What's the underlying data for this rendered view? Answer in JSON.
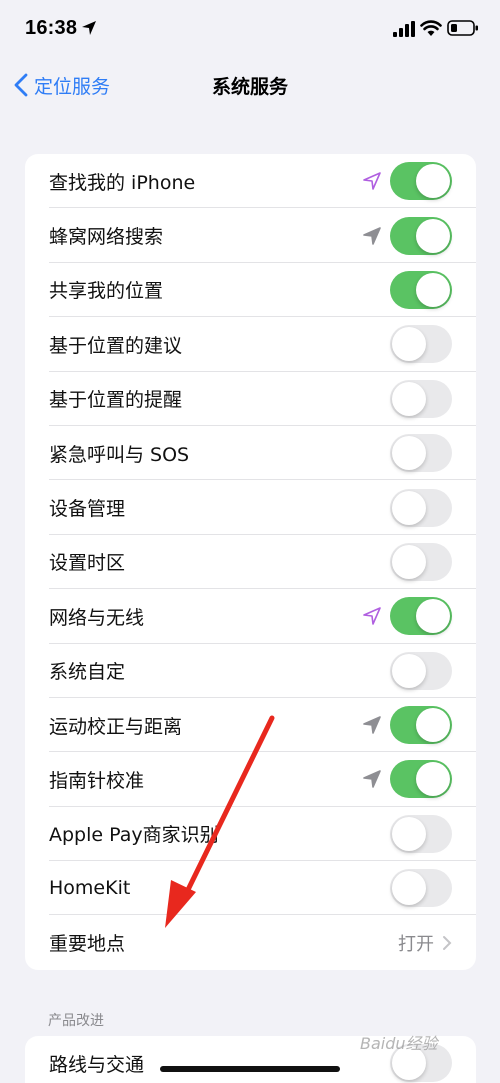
{
  "status_bar": {
    "time": "16:38",
    "icons": [
      "location-arrow-icon",
      "signal-icon",
      "wifi-icon",
      "battery-icon"
    ]
  },
  "nav": {
    "back_label": "定位服务",
    "title": "系统服务"
  },
  "services": [
    {
      "label": "查找我的 iPhone",
      "on": true,
      "indicator": "purple"
    },
    {
      "label": "蜂窝网络搜索",
      "on": true,
      "indicator": "gray"
    },
    {
      "label": "共享我的位置",
      "on": true,
      "indicator": ""
    },
    {
      "label": "基于位置的建议",
      "on": false,
      "indicator": ""
    },
    {
      "label": "基于位置的提醒",
      "on": false,
      "indicator": ""
    },
    {
      "label": "紧急呼叫与 SOS",
      "on": false,
      "indicator": ""
    },
    {
      "label": "设备管理",
      "on": false,
      "indicator": ""
    },
    {
      "label": "设置时区",
      "on": false,
      "indicator": ""
    },
    {
      "label": "网络与无线",
      "on": true,
      "indicator": "purple"
    },
    {
      "label": "系统自定",
      "on": false,
      "indicator": ""
    },
    {
      "label": "运动校正与距离",
      "on": true,
      "indicator": "gray"
    },
    {
      "label": "指南针校准",
      "on": true,
      "indicator": "gray"
    },
    {
      "label": "Apple Pay商家识别",
      "on": false,
      "indicator": ""
    },
    {
      "label": "HomeKit",
      "on": false,
      "indicator": ""
    }
  ],
  "significant_locations": {
    "label": "重要地点",
    "value": "打开"
  },
  "product_improvement": {
    "header": "产品改进",
    "first_item_label": "路线与交通"
  },
  "watermark": "Baidu经验",
  "colors": {
    "toggle_on": "#5ac363",
    "toggle_off": "#e9e9eb",
    "accent": "#2f7df6",
    "indicator_purple": "#b05fe0",
    "indicator_gray": "#8e8e93",
    "annotation_arrow": "#e8281e"
  }
}
